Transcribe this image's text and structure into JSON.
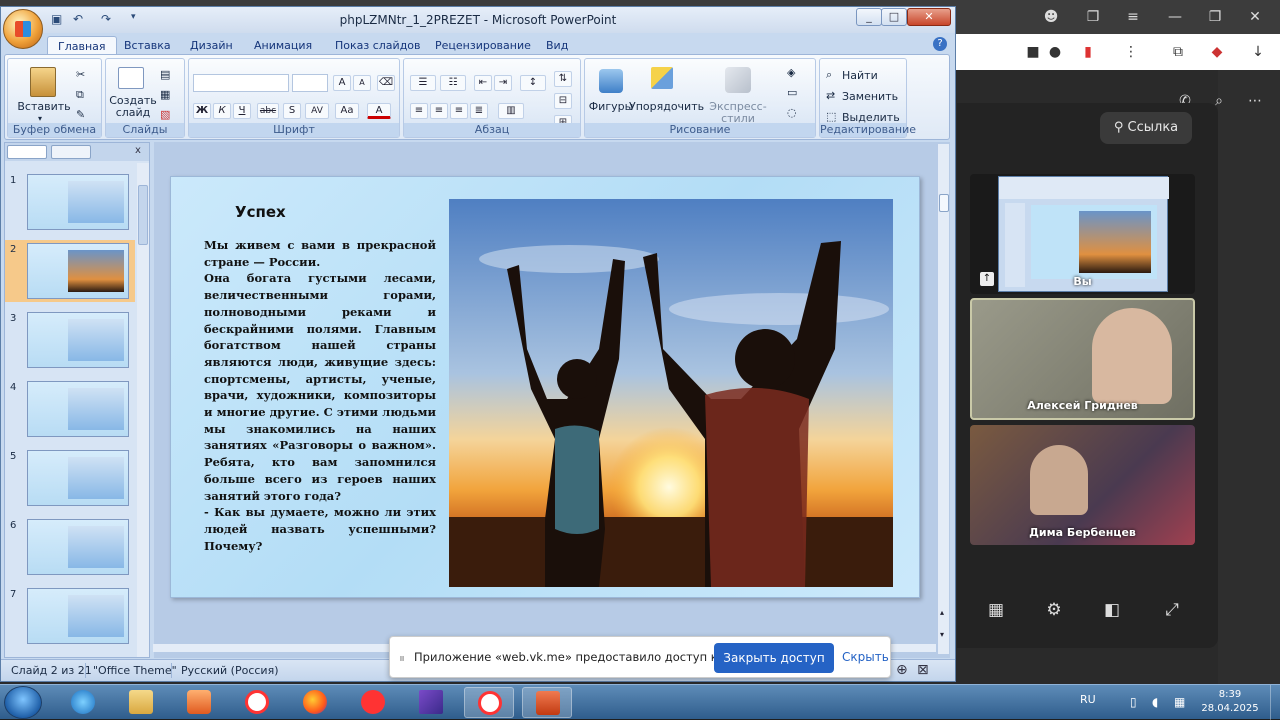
{
  "window": {
    "title": "phpLZMNtr_1_2PREZET - Microsoft PowerPoint",
    "min": "_",
    "max": "□",
    "close": "✕"
  },
  "ribbon_tabs": [
    "Главная",
    "Вставка",
    "Дизайн",
    "Анимация",
    "Показ слайдов",
    "Рецензирование",
    "Вид"
  ],
  "ribbon": {
    "paste": "Вставить",
    "clipboard_group": "Буфер обмена",
    "new_slide": "Создать слайд",
    "slides_group": "Слайды",
    "font_group": "Шрифт",
    "paragraph_group": "Абзац",
    "shapes": "Фигуры",
    "arrange": "Упорядочить",
    "quick_styles": "Экспресс-стили",
    "drawing_group": "Рисование",
    "find": "Найти",
    "replace": "Заменить",
    "select": "Выделить",
    "editing_group": "Редактирование",
    "bold": "Ж",
    "italic": "К",
    "underline": "Ч",
    "strike": "abc",
    "shadow": "S",
    "spacing": "AV",
    "case": "Aa",
    "font_color": "A",
    "grow": "A",
    "shrink": "A"
  },
  "thumbnails": [
    {
      "num": "1"
    },
    {
      "num": "2",
      "selected": true
    },
    {
      "num": "3"
    },
    {
      "num": "4"
    },
    {
      "num": "5"
    },
    {
      "num": "6"
    },
    {
      "num": "7"
    }
  ],
  "slide": {
    "title": "Успех",
    "paragraphs": [
      "Мы живем с вами в прекрасной стране — России.",
      "Она богата густыми лесами, величественными горами, полноводными реками и бескрайними полями. Главным богатством нашей страны являются люди, живущие здесь: спортсмены, артисты, ученые, врачи, художники, композиторы и многие другие. С этими людьми мы знакомились на наших занятиях «Разговоры о важном». Ребята, кто вам запомнился больше всего из героев наших занятий этого года?",
      "- Как вы думаете, можно ли этих людей назвать успешными? Почему?"
    ]
  },
  "status": {
    "slide": "Слайд 2 из 21",
    "theme": "\"Office Theme\"",
    "language": "Русский (Россия)"
  },
  "share_notice": {
    "text": "Приложение «web.vk.me» предоставило доступ к окну.",
    "stop": "Закрыть доступ",
    "hide": "Скрыть"
  },
  "call": {
    "link_button": "Ссылка",
    "participants": [
      {
        "name": "Вы",
        "color": "#3c5a7a"
      },
      {
        "name": "Алексей Гриднев",
        "color": "#8a8a7a"
      },
      {
        "name": "Дима Бербенцев",
        "color": "#6a4a3a"
      }
    ]
  },
  "taskbar": {
    "language": "RU",
    "time": "8:39",
    "date": "28.04.2025"
  },
  "colors": {
    "accent": "#2563c5",
    "selected_thumb": "#f6c98a",
    "slide_bg": "#bfe3f8"
  }
}
